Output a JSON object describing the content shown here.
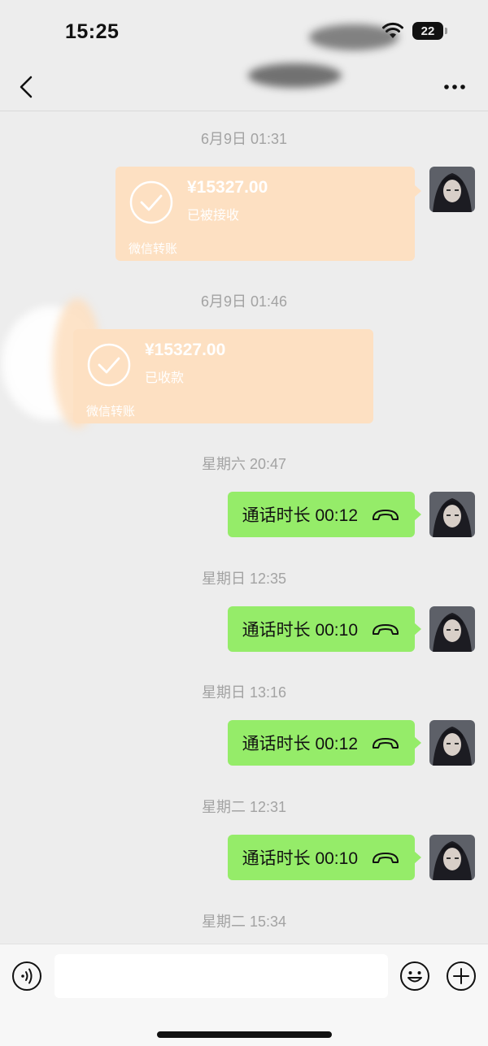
{
  "status_bar": {
    "time": "15:25",
    "battery": "22",
    "wifi_icon": "wifi-icon"
  },
  "nav": {
    "back_icon": "chevron-left-icon",
    "more_icon": "more-horizontal-icon"
  },
  "messages": [
    {
      "type": "timestamp",
      "text": "6月9日 01:31"
    },
    {
      "type": "transfer",
      "direction": "sent",
      "amount": "¥15327.00",
      "status": "已被接收",
      "caption": "微信转账"
    },
    {
      "type": "timestamp",
      "text": "6月9日 01:46"
    },
    {
      "type": "transfer",
      "direction": "received",
      "amount": "¥15327.00",
      "status": "已收款",
      "caption": "微信转账"
    },
    {
      "type": "timestamp",
      "text": "星期六 20:47"
    },
    {
      "type": "call",
      "direction": "sent",
      "text": "通话时长 00:12"
    },
    {
      "type": "timestamp",
      "text": "星期日 12:35"
    },
    {
      "type": "call",
      "direction": "sent",
      "text": "通话时长 00:10"
    },
    {
      "type": "timestamp",
      "text": "星期日 13:16"
    },
    {
      "type": "call",
      "direction": "sent",
      "text": "通话时长 00:12"
    },
    {
      "type": "timestamp",
      "text": "星期二 12:31"
    },
    {
      "type": "call",
      "direction": "sent",
      "text": "通话时长 00:10"
    },
    {
      "type": "timestamp",
      "text": "星期二 15:34"
    }
  ],
  "input_bar": {
    "voice_icon": "voice-icon",
    "emoji_icon": "emoji-icon",
    "plus_icon": "plus-icon",
    "input_value": ""
  },
  "colors": {
    "background": "#ededed",
    "call_bubble": "#95ec69",
    "transfer_bubble": "#fde0c2",
    "timestamp_text": "#a3a3a3"
  }
}
